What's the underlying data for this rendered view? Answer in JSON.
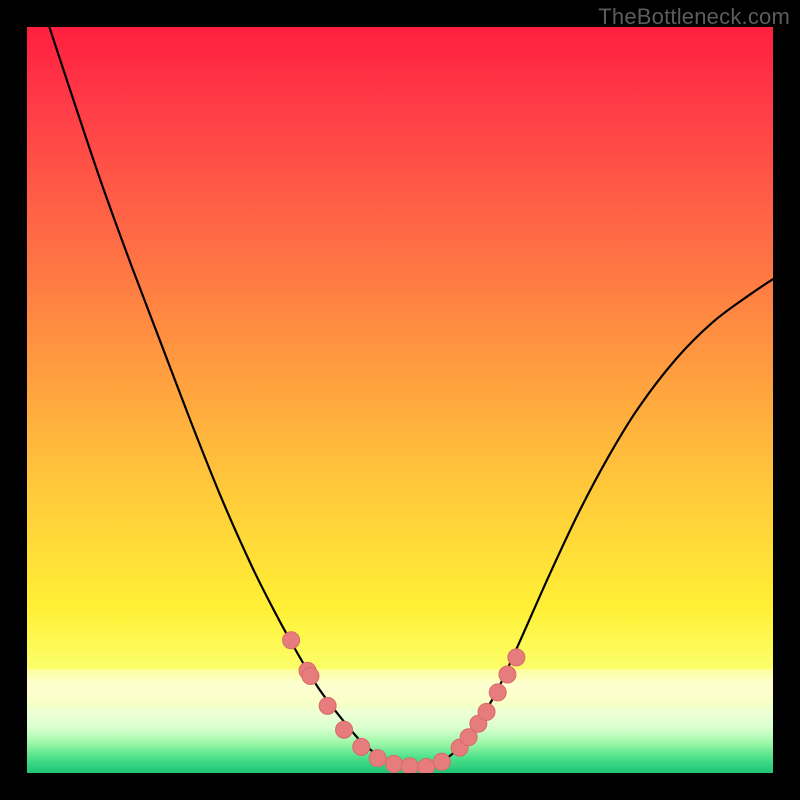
{
  "watermark": "TheBottleneck.com",
  "chart_data": {
    "type": "line",
    "title": "",
    "xlabel": "",
    "ylabel": "",
    "xlim": [
      0,
      1
    ],
    "ylim": [
      0,
      1
    ],
    "grid": false,
    "legend": false,
    "colors": {
      "curve": "#000000",
      "marker_fill": "#e77c7c",
      "marker_stroke": "#d96a6a"
    },
    "series": [
      {
        "name": "bottleneck-curve",
        "type": "line",
        "x": [
          0.03,
          0.063,
          0.1,
          0.14,
          0.18,
          0.22,
          0.26,
          0.3,
          0.33,
          0.36,
          0.39,
          0.42,
          0.45,
          0.48,
          0.5,
          0.52,
          0.54,
          0.56,
          0.58,
          0.6,
          0.63,
          0.66,
          0.7,
          0.74,
          0.78,
          0.82,
          0.87,
          0.92,
          0.97,
          1.0
        ],
        "y": [
          1.0,
          0.9,
          0.79,
          0.68,
          0.575,
          0.47,
          0.37,
          0.28,
          0.22,
          0.165,
          0.115,
          0.075,
          0.04,
          0.018,
          0.01,
          0.008,
          0.01,
          0.018,
          0.035,
          0.06,
          0.11,
          0.175,
          0.265,
          0.35,
          0.425,
          0.49,
          0.555,
          0.605,
          0.642,
          0.662
        ]
      },
      {
        "name": "left-markers",
        "type": "scatter",
        "x": [
          0.354,
          0.376,
          0.38,
          0.403,
          0.425,
          0.448,
          0.47,
          0.492,
          0.513,
          0.535
        ],
        "y": [
          0.178,
          0.137,
          0.13,
          0.09,
          0.058,
          0.035,
          0.02,
          0.012,
          0.009,
          0.008
        ]
      },
      {
        "name": "right-markers",
        "type": "scatter",
        "x": [
          0.556,
          0.58,
          0.592,
          0.605,
          0.616,
          0.631,
          0.644,
          0.656
        ],
        "y": [
          0.015,
          0.034,
          0.048,
          0.066,
          0.082,
          0.108,
          0.132,
          0.155
        ]
      }
    ]
  }
}
